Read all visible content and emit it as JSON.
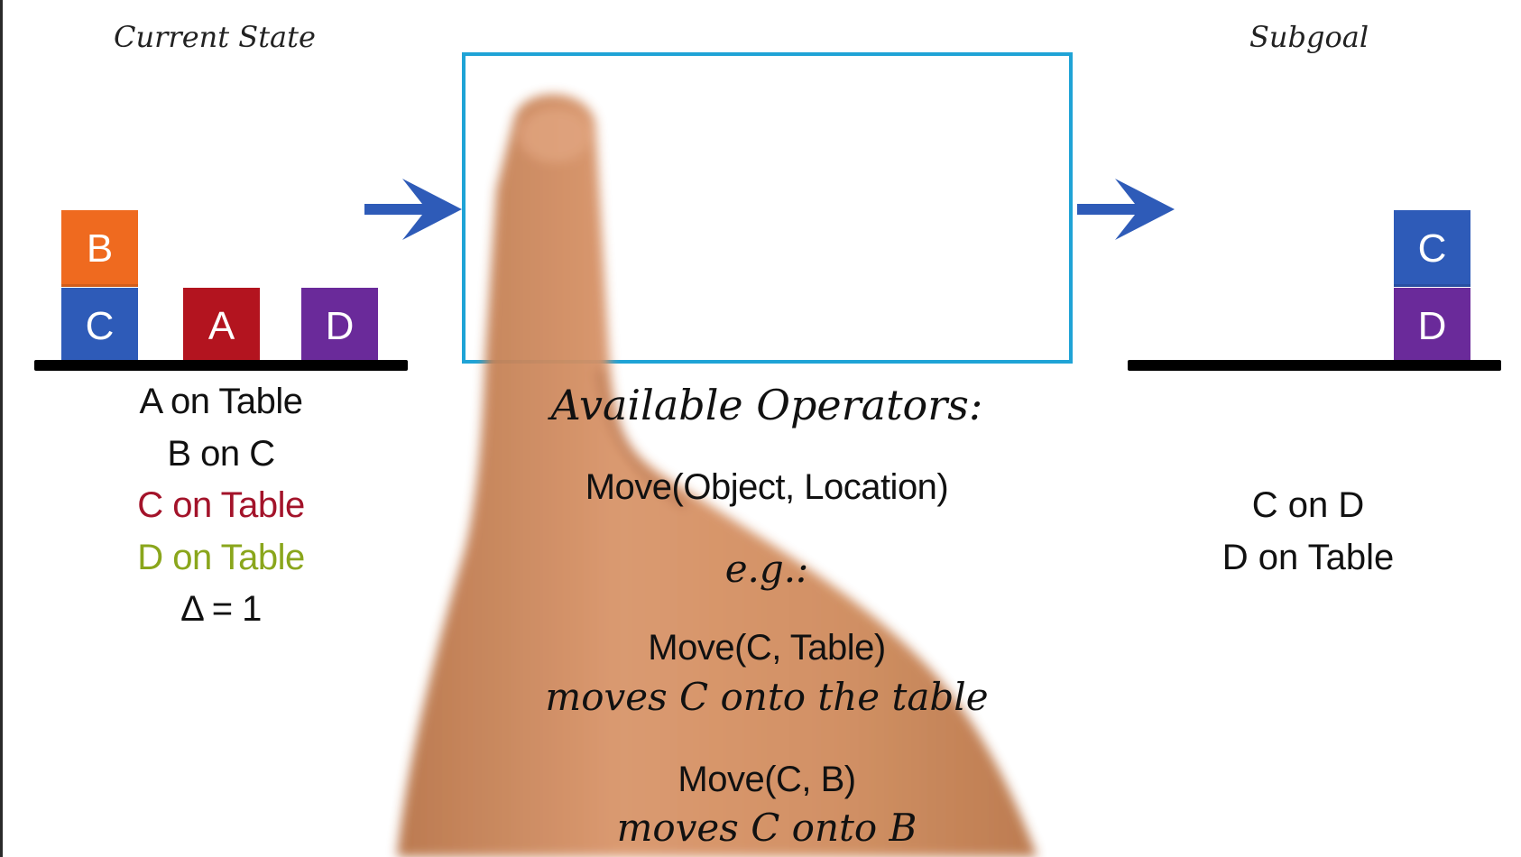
{
  "titles": {
    "current_state": "Current State",
    "subgoal": "Subgoal"
  },
  "current_state": {
    "blocks": [
      {
        "label": "B",
        "color": "#ef6a1f"
      },
      {
        "label": "C",
        "color": "#2e5bb8"
      },
      {
        "label": "A",
        "color": "#b3141f"
      },
      {
        "label": "D",
        "color": "#6a2a9a"
      }
    ],
    "facts": [
      {
        "text": "A on Table",
        "color": "#111111"
      },
      {
        "text": "B on C",
        "color": "#111111"
      },
      {
        "text": "C on Table",
        "color": "#a3132a"
      },
      {
        "text": "D on Table",
        "color": "#8aa61c"
      },
      {
        "text": "Δ = 1",
        "color": "#111111"
      }
    ]
  },
  "subgoal": {
    "blocks": [
      {
        "label": "C",
        "color": "#2e5bb8"
      },
      {
        "label": "D",
        "color": "#6a2a9a"
      }
    ],
    "facts": [
      "C on D",
      "D on Table"
    ]
  },
  "operators": {
    "heading": "Available Operators:",
    "signature": "Move(Object, Location)",
    "eg": "e.g.:",
    "example1_call": "Move(C, Table)",
    "example1_desc": "moves C onto the table",
    "example2_call": "Move(C, B)",
    "example2_desc": "moves C onto B"
  },
  "colors": {
    "arrow": "#2e5bb8",
    "box_border": "#1fa3d6",
    "hand": "#d08a5a"
  }
}
